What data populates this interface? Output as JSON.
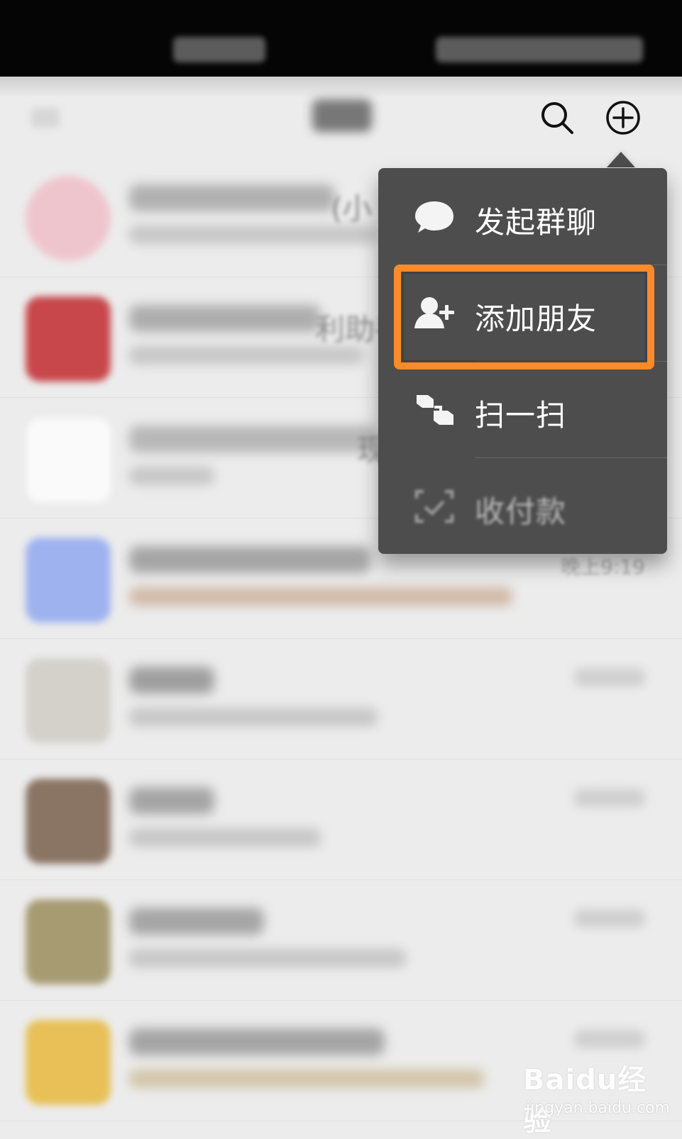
{
  "menu": {
    "items": [
      {
        "label": "发起群聊",
        "icon": "chat-bubble-icon"
      },
      {
        "label": "添加朋友",
        "icon": "add-friend-icon"
      },
      {
        "label": "扫一扫",
        "icon": "scan-icon"
      },
      {
        "label": "收付款",
        "icon": "payment-icon"
      }
    ]
  },
  "chat_list": {
    "visible_time": "晚上9:19",
    "partial_text_1": "(小",
    "partial_text_2": "利助手",
    "partial_text_3": "现"
  },
  "highlight": {
    "color": "#ff8a2a"
  },
  "watermark": {
    "brand": "Baidu经验",
    "url": "jingyan.baidu.com"
  }
}
